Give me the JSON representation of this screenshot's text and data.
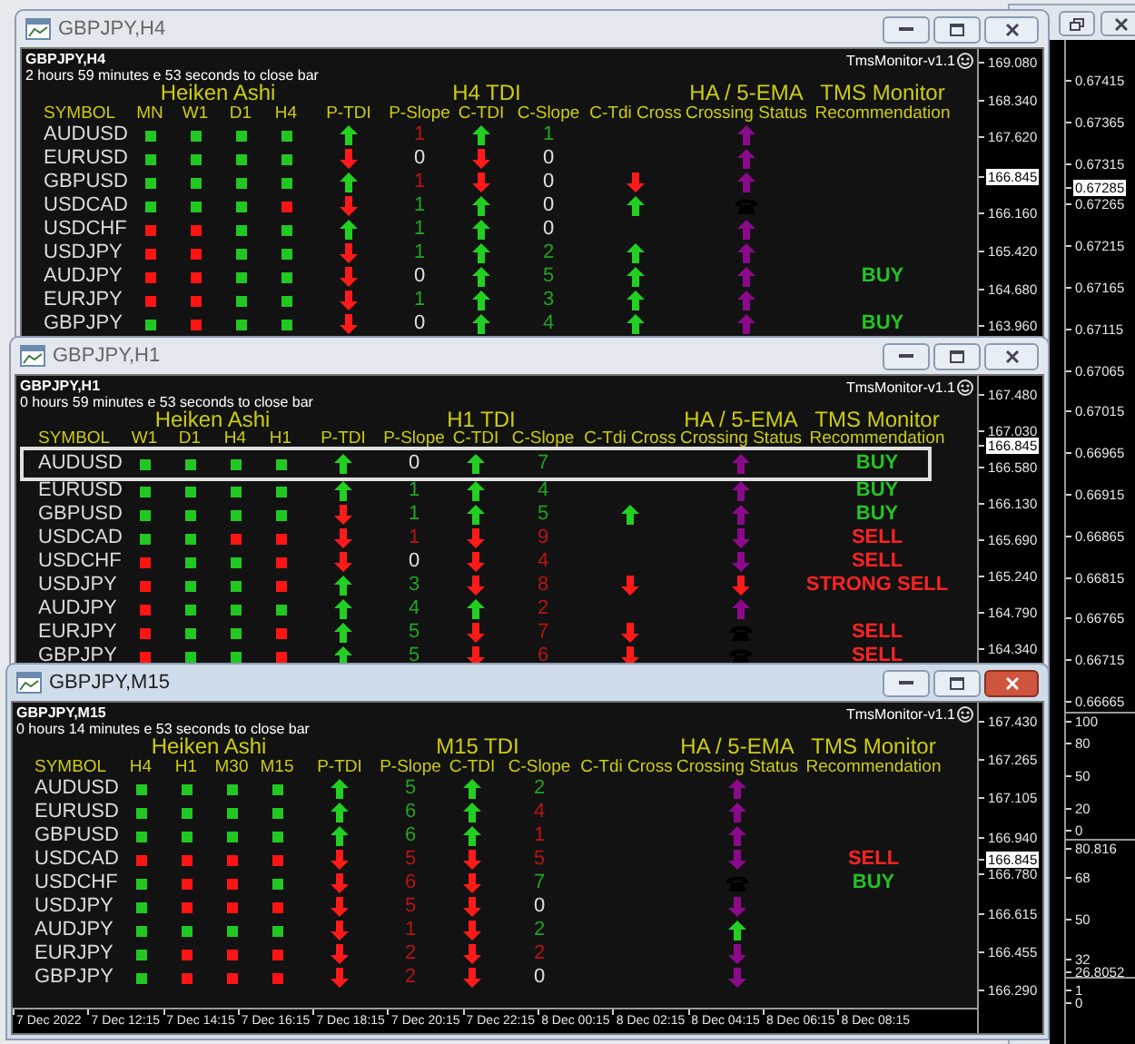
{
  "background_chart": {
    "price_axis": [
      {
        "label": "0.67415",
        "current": false
      },
      {
        "label": "0.67365",
        "current": false
      },
      {
        "label": "0.67315",
        "current": false
      },
      {
        "label": "0.67285",
        "current": true
      },
      {
        "label": "0.67265",
        "current": false
      },
      {
        "label": "0.67215",
        "current": false
      },
      {
        "label": "0.67165",
        "current": false
      },
      {
        "label": "0.67115",
        "current": false
      },
      {
        "label": "0.67065",
        "current": false
      },
      {
        "label": "0.67015",
        "current": false
      },
      {
        "label": "0.66965",
        "current": false
      },
      {
        "label": "0.66915",
        "current": false
      },
      {
        "label": "0.66865",
        "current": false
      },
      {
        "label": "0.66815",
        "current": false
      },
      {
        "label": "0.66765",
        "current": false
      },
      {
        "label": "0.66715",
        "current": false
      },
      {
        "label": "0.66665",
        "current": false
      }
    ],
    "indicator_axes": [
      [
        "100",
        "80",
        "50",
        "20",
        "0"
      ],
      [
        "80.816",
        "68",
        "50",
        "32",
        "26.8052"
      ],
      [
        "1",
        "0"
      ]
    ]
  },
  "windows": [
    {
      "title": "GBPJPY,H4",
      "active": false,
      "chart_label": "GBPJPY,H4",
      "countdown": "2 hours 59 minutes e 53 seconds to close bar",
      "version": "TmsMonitor-v1.1",
      "ha_title": "Heiken Ashi",
      "tdi_title": "H4 TDI",
      "crossing_title": "HA / 5-EMA",
      "rec_title": "TMS Monitor",
      "columns": {
        "symbol": "SYMBOL",
        "ha": [
          "MN",
          "W1",
          "D1",
          "H4"
        ],
        "p_tdi": "P-TDI",
        "p_slope": "P-Slope",
        "c_tdi": "C-TDI",
        "c_slope": "C-Slope",
        "cross": "C-Tdi Cross",
        "crossing": "Crossing Status",
        "rec": "Recommendation"
      },
      "rows": [
        {
          "symbol": "AUDUSD",
          "selected": false,
          "ha_bullish": [
            true,
            true,
            true,
            true
          ],
          "p_tdi_rising": true,
          "p_slope": {
            "value": "1",
            "color": "#b81414"
          },
          "c_tdi_rising": true,
          "c_slope": {
            "value": "1",
            "color": "#23a323"
          },
          "crossing": {
            "kind": "arrow",
            "rising": true,
            "color": "#8a0a8a"
          }
        },
        {
          "symbol": "EURUSD",
          "selected": false,
          "ha_bullish": [
            true,
            true,
            true,
            true
          ],
          "p_tdi_rising": false,
          "p_slope": {
            "value": "0",
            "color": "#e0e0e0"
          },
          "c_tdi_rising": false,
          "c_slope": {
            "value": "0",
            "color": "#e0e0e0"
          },
          "crossing": {
            "kind": "arrow",
            "rising": true,
            "color": "#8a0a8a"
          }
        },
        {
          "symbol": "GBPUSD",
          "selected": false,
          "ha_bullish": [
            true,
            true,
            true,
            true
          ],
          "p_tdi_rising": true,
          "p_slope": {
            "value": "1",
            "color": "#b81414"
          },
          "c_tdi_rising": false,
          "c_slope": {
            "value": "0",
            "color": "#e0e0e0"
          },
          "cross_rising": false,
          "crossing": {
            "kind": "arrow",
            "rising": true,
            "color": "#8a0a8a"
          }
        },
        {
          "symbol": "USDCAD",
          "selected": false,
          "ha_bullish": [
            true,
            true,
            true,
            false
          ],
          "p_tdi_rising": false,
          "p_slope": {
            "value": "1",
            "color": "#23a323"
          },
          "c_tdi_rising": true,
          "c_slope": {
            "value": "0",
            "color": "#e0e0e0"
          },
          "cross_rising": true,
          "crossing": {
            "kind": "phone"
          }
        },
        {
          "symbol": "USDCHF",
          "selected": false,
          "ha_bullish": [
            false,
            false,
            true,
            true
          ],
          "p_tdi_rising": true,
          "p_slope": {
            "value": "1",
            "color": "#23a323"
          },
          "c_tdi_rising": true,
          "c_slope": {
            "value": "0",
            "color": "#e0e0e0"
          },
          "crossing": {
            "kind": "arrow",
            "rising": true,
            "color": "#8a0a8a"
          }
        },
        {
          "symbol": "USDJPY",
          "selected": false,
          "ha_bullish": [
            false,
            false,
            true,
            true
          ],
          "p_tdi_rising": false,
          "p_slope": {
            "value": "1",
            "color": "#23a323"
          },
          "c_tdi_rising": true,
          "c_slope": {
            "value": "2",
            "color": "#23a323"
          },
          "cross_rising": true,
          "crossing": {
            "kind": "arrow",
            "rising": true,
            "color": "#8a0a8a"
          }
        },
        {
          "symbol": "AUDJPY",
          "selected": false,
          "ha_bullish": [
            false,
            false,
            true,
            true
          ],
          "p_tdi_rising": false,
          "p_slope": {
            "value": "0",
            "color": "#e0e0e0"
          },
          "c_tdi_rising": true,
          "c_slope": {
            "value": "5",
            "color": "#23a323"
          },
          "cross_rising": true,
          "crossing": {
            "kind": "arrow",
            "rising": true,
            "color": "#8a0a8a"
          },
          "rec": {
            "text": "BUY",
            "color": "#25c225"
          }
        },
        {
          "symbol": "EURJPY",
          "selected": false,
          "ha_bullish": [
            false,
            false,
            true,
            true
          ],
          "p_tdi_rising": false,
          "p_slope": {
            "value": "1",
            "color": "#23a323"
          },
          "c_tdi_rising": true,
          "c_slope": {
            "value": "3",
            "color": "#23a323"
          },
          "cross_rising": true,
          "crossing": {
            "kind": "arrow",
            "rising": true,
            "color": "#8a0a8a"
          }
        },
        {
          "symbol": "GBPJPY",
          "selected": false,
          "ha_bullish": [
            true,
            false,
            true,
            true
          ],
          "p_tdi_rising": false,
          "p_slope": {
            "value": "0",
            "color": "#e0e0e0"
          },
          "c_tdi_rising": true,
          "c_slope": {
            "value": "4",
            "color": "#23a323"
          },
          "cross_rising": true,
          "crossing": {
            "kind": "arrow",
            "rising": true,
            "color": "#8a0a8a"
          },
          "rec": {
            "text": "BUY",
            "color": "#25c225"
          }
        }
      ],
      "price_axis": [
        {
          "label": "169.080",
          "current": false
        },
        {
          "label": "168.340",
          "current": false
        },
        {
          "label": "167.620",
          "current": false
        },
        {
          "label": "166.845",
          "current": true
        },
        {
          "label": "166.160",
          "current": false
        },
        {
          "label": "165.420",
          "current": false
        },
        {
          "label": "164.680",
          "current": false
        },
        {
          "label": "163.960",
          "current": false
        }
      ]
    },
    {
      "title": "GBPJPY,H1",
      "active": false,
      "chart_label": "GBPJPY,H1",
      "countdown": "0 hours 59 minutes e 53 seconds to close bar",
      "version": "TmsMonitor-v1.1",
      "ha_title": "Heiken Ashi",
      "tdi_title": "H1 TDI",
      "crossing_title": "HA / 5-EMA",
      "rec_title": "TMS Monitor",
      "columns": {
        "symbol": "SYMBOL",
        "ha": [
          "W1",
          "D1",
          "H4",
          "H1"
        ],
        "p_tdi": "P-TDI",
        "p_slope": "P-Slope",
        "c_tdi": "C-TDI",
        "c_slope": "C-Slope",
        "cross": "C-Tdi Cross",
        "crossing": "Crossing Status",
        "rec": "Recommendation"
      },
      "rows": [
        {
          "symbol": "AUDUSD",
          "selected": true,
          "ha_bullish": [
            true,
            true,
            true,
            true
          ],
          "p_tdi_rising": true,
          "p_slope": {
            "value": "0",
            "color": "#e0e0e0"
          },
          "c_tdi_rising": true,
          "c_slope": {
            "value": "7",
            "color": "#23a323"
          },
          "crossing": {
            "kind": "arrow",
            "rising": true,
            "color": "#8a0a8a"
          },
          "rec": {
            "text": "BUY",
            "color": "#25c225"
          }
        },
        {
          "symbol": "EURUSD",
          "selected": false,
          "ha_bullish": [
            true,
            true,
            true,
            true
          ],
          "p_tdi_rising": true,
          "p_slope": {
            "value": "1",
            "color": "#23a323"
          },
          "c_tdi_rising": true,
          "c_slope": {
            "value": "4",
            "color": "#23a323"
          },
          "crossing": {
            "kind": "arrow",
            "rising": true,
            "color": "#8a0a8a"
          },
          "rec": {
            "text": "BUY",
            "color": "#25c225"
          }
        },
        {
          "symbol": "GBPUSD",
          "selected": false,
          "ha_bullish": [
            true,
            true,
            true,
            true
          ],
          "p_tdi_rising": false,
          "p_slope": {
            "value": "1",
            "color": "#23a323"
          },
          "c_tdi_rising": true,
          "c_slope": {
            "value": "5",
            "color": "#23a323"
          },
          "cross_rising": true,
          "crossing": {
            "kind": "arrow",
            "rising": true,
            "color": "#8a0a8a"
          },
          "rec": {
            "text": "BUY",
            "color": "#25c225"
          }
        },
        {
          "symbol": "USDCAD",
          "selected": false,
          "ha_bullish": [
            true,
            true,
            false,
            false
          ],
          "p_tdi_rising": false,
          "p_slope": {
            "value": "1",
            "color": "#b81414"
          },
          "c_tdi_rising": false,
          "c_slope": {
            "value": "9",
            "color": "#b81414"
          },
          "crossing": {
            "kind": "arrow",
            "rising": false,
            "color": "#8a0a8a"
          },
          "rec": {
            "text": "SELL",
            "color": "#ff2222"
          }
        },
        {
          "symbol": "USDCHF",
          "selected": false,
          "ha_bullish": [
            false,
            true,
            true,
            false
          ],
          "p_tdi_rising": false,
          "p_slope": {
            "value": "0",
            "color": "#e0e0e0"
          },
          "c_tdi_rising": false,
          "c_slope": {
            "value": "4",
            "color": "#b81414"
          },
          "crossing": {
            "kind": "arrow",
            "rising": false,
            "color": "#8a0a8a"
          },
          "rec": {
            "text": "SELL",
            "color": "#ff2222"
          }
        },
        {
          "symbol": "USDJPY",
          "selected": false,
          "ha_bullish": [
            false,
            true,
            true,
            false
          ],
          "p_tdi_rising": true,
          "p_slope": {
            "value": "3",
            "color": "#23a323"
          },
          "c_tdi_rising": false,
          "c_slope": {
            "value": "8",
            "color": "#b81414"
          },
          "cross_rising": false,
          "crossing": {
            "kind": "arrow",
            "rising": false,
            "color": "#ff1a1a"
          },
          "rec": {
            "text": "STRONG SELL",
            "color": "#ff2222"
          }
        },
        {
          "symbol": "AUDJPY",
          "selected": false,
          "ha_bullish": [
            false,
            true,
            true,
            true
          ],
          "p_tdi_rising": true,
          "p_slope": {
            "value": "4",
            "color": "#23a323"
          },
          "c_tdi_rising": true,
          "c_slope": {
            "value": "2",
            "color": "#b81414"
          },
          "crossing": {
            "kind": "arrow",
            "rising": true,
            "color": "#8a0a8a"
          }
        },
        {
          "symbol": "EURJPY",
          "selected": false,
          "ha_bullish": [
            false,
            true,
            true,
            false
          ],
          "p_tdi_rising": true,
          "p_slope": {
            "value": "5",
            "color": "#23a323"
          },
          "c_tdi_rising": false,
          "c_slope": {
            "value": "7",
            "color": "#b81414"
          },
          "cross_rising": false,
          "crossing": {
            "kind": "phone"
          },
          "rec": {
            "text": "SELL",
            "color": "#ff2222"
          }
        },
        {
          "symbol": "GBPJPY",
          "selected": false,
          "ha_bullish": [
            false,
            true,
            true,
            false
          ],
          "p_tdi_rising": true,
          "p_slope": {
            "value": "5",
            "color": "#23a323"
          },
          "c_tdi_rising": false,
          "c_slope": {
            "value": "6",
            "color": "#b81414"
          },
          "cross_rising": false,
          "crossing": {
            "kind": "phone"
          },
          "rec": {
            "text": "SELL",
            "color": "#ff2222"
          }
        }
      ],
      "price_axis": [
        {
          "label": "167.480",
          "current": false
        },
        {
          "label": "167.030",
          "current": false
        },
        {
          "label": "166.845",
          "current": true
        },
        {
          "label": "166.580",
          "current": false
        },
        {
          "label": "166.130",
          "current": false
        },
        {
          "label": "165.690",
          "current": false
        },
        {
          "label": "165.240",
          "current": false
        },
        {
          "label": "164.790",
          "current": false
        },
        {
          "label": "164.340",
          "current": false
        }
      ]
    },
    {
      "title": "GBPJPY,M15",
      "active": true,
      "chart_label": "GBPJPY,M15",
      "countdown": "0 hours 14 minutes e 53 seconds to close bar",
      "version": "TmsMonitor-v1.1",
      "ha_title": "Heiken Ashi",
      "tdi_title": "M15 TDI",
      "crossing_title": "HA / 5-EMA",
      "rec_title": "TMS Monitor",
      "columns": {
        "symbol": "SYMBOL",
        "ha": [
          "H4",
          "H1",
          "M30",
          "M15"
        ],
        "p_tdi": "P-TDI",
        "p_slope": "P-Slope",
        "c_tdi": "C-TDI",
        "c_slope": "C-Slope",
        "cross": "C-Tdi Cross",
        "crossing": "Crossing Status",
        "rec": "Recommendation"
      },
      "rows": [
        {
          "symbol": "AUDUSD",
          "selected": false,
          "ha_bullish": [
            true,
            true,
            true,
            true
          ],
          "p_tdi_rising": true,
          "p_slope": {
            "value": "5",
            "color": "#23a323"
          },
          "c_tdi_rising": true,
          "c_slope": {
            "value": "2",
            "color": "#23a323"
          },
          "crossing": {
            "kind": "arrow",
            "rising": true,
            "color": "#8a0a8a"
          }
        },
        {
          "symbol": "EURUSD",
          "selected": false,
          "ha_bullish": [
            true,
            true,
            true,
            true
          ],
          "p_tdi_rising": true,
          "p_slope": {
            "value": "6",
            "color": "#23a323"
          },
          "c_tdi_rising": true,
          "c_slope": {
            "value": "4",
            "color": "#b81414"
          },
          "crossing": {
            "kind": "arrow",
            "rising": true,
            "color": "#8a0a8a"
          }
        },
        {
          "symbol": "GBPUSD",
          "selected": false,
          "ha_bullish": [
            true,
            true,
            true,
            true
          ],
          "p_tdi_rising": true,
          "p_slope": {
            "value": "6",
            "color": "#23a323"
          },
          "c_tdi_rising": true,
          "c_slope": {
            "value": "1",
            "color": "#b81414"
          },
          "crossing": {
            "kind": "arrow",
            "rising": true,
            "color": "#8a0a8a"
          }
        },
        {
          "symbol": "USDCAD",
          "selected": false,
          "ha_bullish": [
            false,
            false,
            false,
            false
          ],
          "p_tdi_rising": false,
          "p_slope": {
            "value": "5",
            "color": "#b81414"
          },
          "c_tdi_rising": false,
          "c_slope": {
            "value": "5",
            "color": "#b81414"
          },
          "crossing": {
            "kind": "arrow",
            "rising": false,
            "color": "#8a0a8a"
          },
          "rec": {
            "text": "SELL",
            "color": "#ff2222"
          }
        },
        {
          "symbol": "USDCHF",
          "selected": false,
          "ha_bullish": [
            true,
            false,
            false,
            true
          ],
          "p_tdi_rising": false,
          "p_slope": {
            "value": "6",
            "color": "#b81414"
          },
          "c_tdi_rising": false,
          "c_slope": {
            "value": "7",
            "color": "#23a323"
          },
          "crossing": {
            "kind": "phone"
          },
          "rec": {
            "text": "BUY",
            "color": "#25c225"
          }
        },
        {
          "symbol": "USDJPY",
          "selected": false,
          "ha_bullish": [
            true,
            false,
            false,
            false
          ],
          "p_tdi_rising": false,
          "p_slope": {
            "value": "5",
            "color": "#b81414"
          },
          "c_tdi_rising": false,
          "c_slope": {
            "value": "0",
            "color": "#e0e0e0"
          },
          "crossing": {
            "kind": "arrow",
            "rising": false,
            "color": "#8a0a8a"
          }
        },
        {
          "symbol": "AUDJPY",
          "selected": false,
          "ha_bullish": [
            true,
            true,
            true,
            true
          ],
          "p_tdi_rising": false,
          "p_slope": {
            "value": "1",
            "color": "#b81414"
          },
          "c_tdi_rising": false,
          "c_slope": {
            "value": "2",
            "color": "#23a323"
          },
          "crossing": {
            "kind": "arrow",
            "rising": true,
            "color": "#22d022"
          }
        },
        {
          "symbol": "EURJPY",
          "selected": false,
          "ha_bullish": [
            true,
            false,
            false,
            false
          ],
          "p_tdi_rising": false,
          "p_slope": {
            "value": "2",
            "color": "#b81414"
          },
          "c_tdi_rising": false,
          "c_slope": {
            "value": "2",
            "color": "#b81414"
          },
          "crossing": {
            "kind": "arrow",
            "rising": false,
            "color": "#8a0a8a"
          }
        },
        {
          "symbol": "GBPJPY",
          "selected": false,
          "ha_bullish": [
            true,
            false,
            false,
            false
          ],
          "p_tdi_rising": false,
          "p_slope": {
            "value": "2",
            "color": "#b81414"
          },
          "c_tdi_rising": false,
          "c_slope": {
            "value": "0",
            "color": "#e0e0e0"
          },
          "crossing": {
            "kind": "arrow",
            "rising": false,
            "color": "#8a0a8a"
          }
        }
      ],
      "price_axis": [
        {
          "label": "167.430",
          "current": false
        },
        {
          "label": "167.265",
          "current": false
        },
        {
          "label": "167.105",
          "current": false
        },
        {
          "label": "166.940",
          "current": false
        },
        {
          "label": "166.845",
          "current": true
        },
        {
          "label": "166.780",
          "current": false
        },
        {
          "label": "166.615",
          "current": false
        },
        {
          "label": "166.455",
          "current": false
        },
        {
          "label": "166.290",
          "current": false
        }
      ],
      "time_axis": [
        "7 Dec 2022",
        "7 Dec 12:15",
        "7 Dec 14:15",
        "7 Dec 16:15",
        "7 Dec 18:15",
        "7 Dec 20:15",
        "7 Dec 22:15",
        "8 Dec 00:15",
        "8 Dec 02:15",
        "8 Dec 04:15",
        "8 Dec 06:15",
        "8 Dec 08:15"
      ]
    }
  ]
}
